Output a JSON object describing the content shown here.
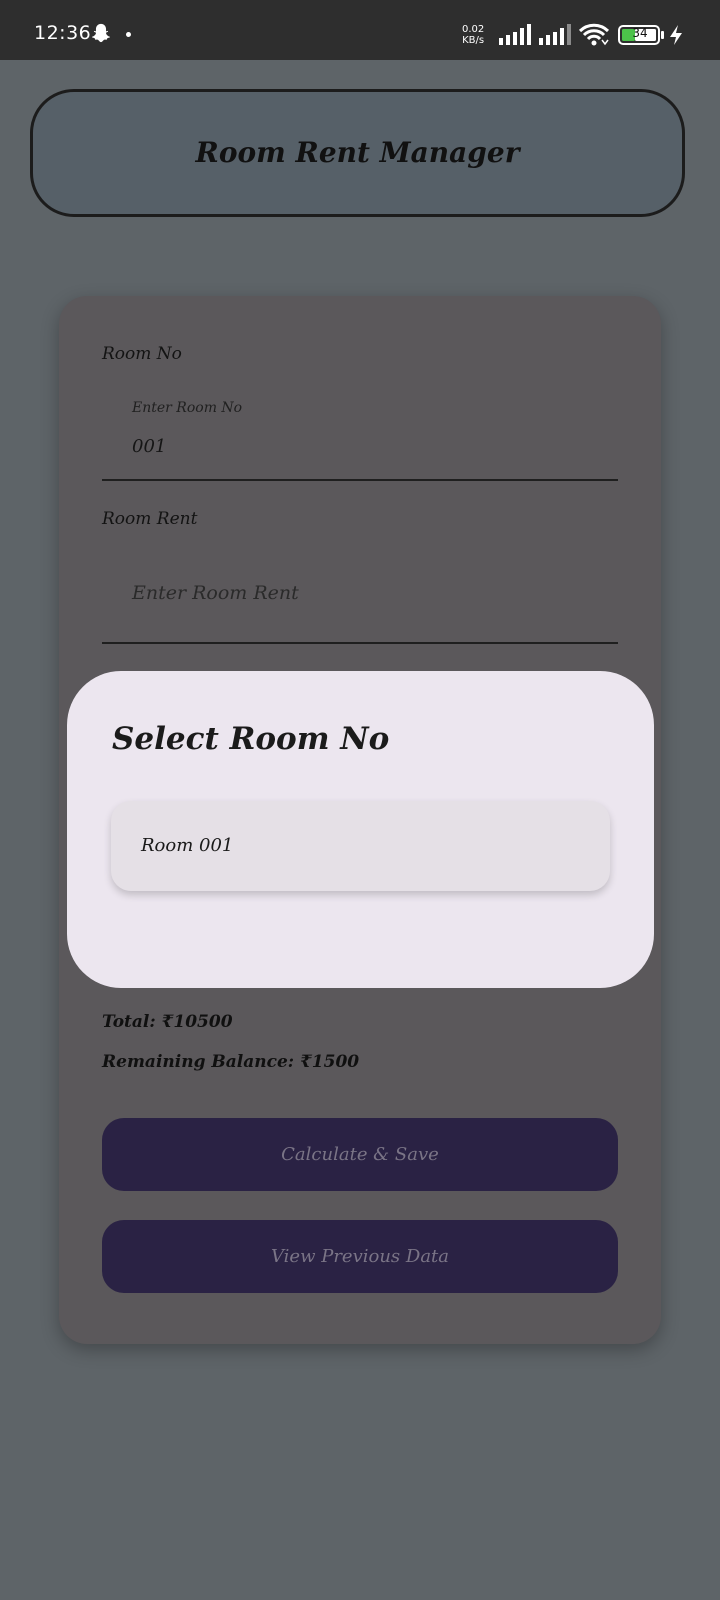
{
  "status_bar": {
    "time": "12:36",
    "net_speed_value": "0.02",
    "net_speed_unit": "KB/s",
    "battery_level": "34",
    "icons": [
      "snapchat-icon",
      "dot-icon",
      "signal-icon",
      "wifi-icon",
      "battery-icon",
      "charging-icon"
    ]
  },
  "header": {
    "title": "Room Rent Manager"
  },
  "form": {
    "room_no": {
      "label": "Room No",
      "floating_label": "Enter Room No",
      "value": "001"
    },
    "room_rent": {
      "label": "Room Rent",
      "placeholder": "Enter Room Rent"
    },
    "total_text": "Total: ₹10500",
    "remaining_text": "Remaining Balance: ₹1500",
    "calculate_button": "Calculate & Save",
    "view_button": "View Previous Data"
  },
  "dialog": {
    "title": "Select Room No",
    "options": [
      "Room 001"
    ]
  },
  "colors": {
    "background": "#5e6468",
    "card": "#5b585b",
    "dialog": "#ece6ef",
    "button": "#2a2244"
  }
}
